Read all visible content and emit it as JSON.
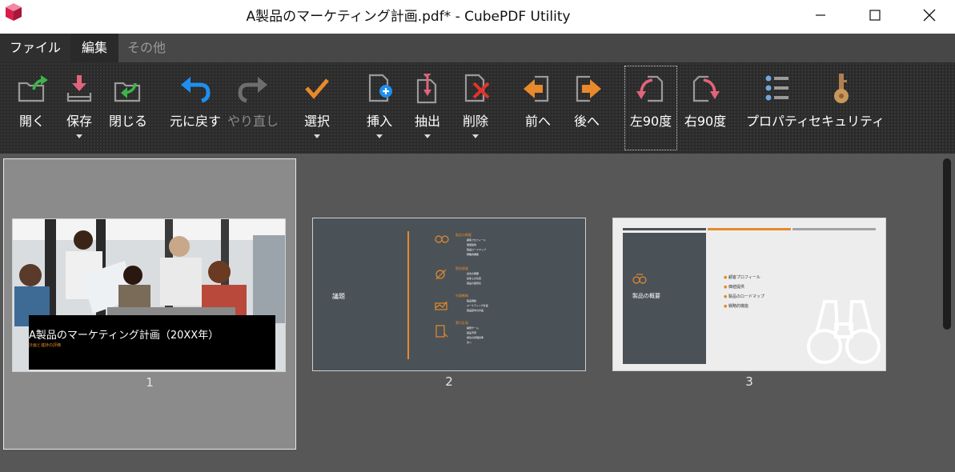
{
  "window": {
    "title": "A製品のマーケティング計画.pdf* - CubePDF Utility"
  },
  "menu": {
    "tabs": [
      {
        "label": "ファイル"
      },
      {
        "label": "編集"
      },
      {
        "label": "その他"
      }
    ]
  },
  "ribbon": {
    "open": "開く",
    "save": "保存",
    "close": "閉じる",
    "undo": "元に戻す",
    "redo": "やり直し",
    "select": "選択",
    "insert": "挿入",
    "extract": "抽出",
    "delete": "削除",
    "prev": "前へ",
    "next": "後へ",
    "rotate_left": "左90度",
    "rotate_right": "右90度",
    "properties": "プロパティ",
    "security": "セキュリティ"
  },
  "colors": {
    "accent_orange": "#e8892b",
    "undo_blue": "#1e8ff0",
    "rotate_pink": "#e0657a",
    "delete_red": "#e0342c",
    "green": "#3bb54a",
    "slide_dark": "#4a5257"
  },
  "pages": [
    {
      "number": "1",
      "slide_title": "A製品のマーケティング計画（20XX年）",
      "slide_subtitle": "計画と進捗の評価"
    },
    {
      "number": "2",
      "slide_heading": "議題",
      "agenda": [
        {
          "title": "製品の概要",
          "items": [
            "顧客プロフィール",
            "価値提供",
            "製品ロードマップ",
            "戦略的機能"
          ]
        },
        {
          "title": "競合調査",
          "items": [
            "競合の概要",
            "競争上の位置",
            "製品の差別化"
          ]
        },
        {
          "title": "市場戦略",
          "items": [
            "製品価格",
            "マーケティング計画",
            "製品配布の計画"
          ]
        },
        {
          "title": "実行計画",
          "items": [
            "開発チーム",
            "製品予算",
            "成功の評価基準",
            "次へ"
          ]
        }
      ]
    },
    {
      "number": "3",
      "slide_heading": "製品の概要",
      "bullets": [
        "顧客プロフィール",
        "価値提供",
        "製品のロードマップ",
        "戦略的機能"
      ]
    }
  ]
}
